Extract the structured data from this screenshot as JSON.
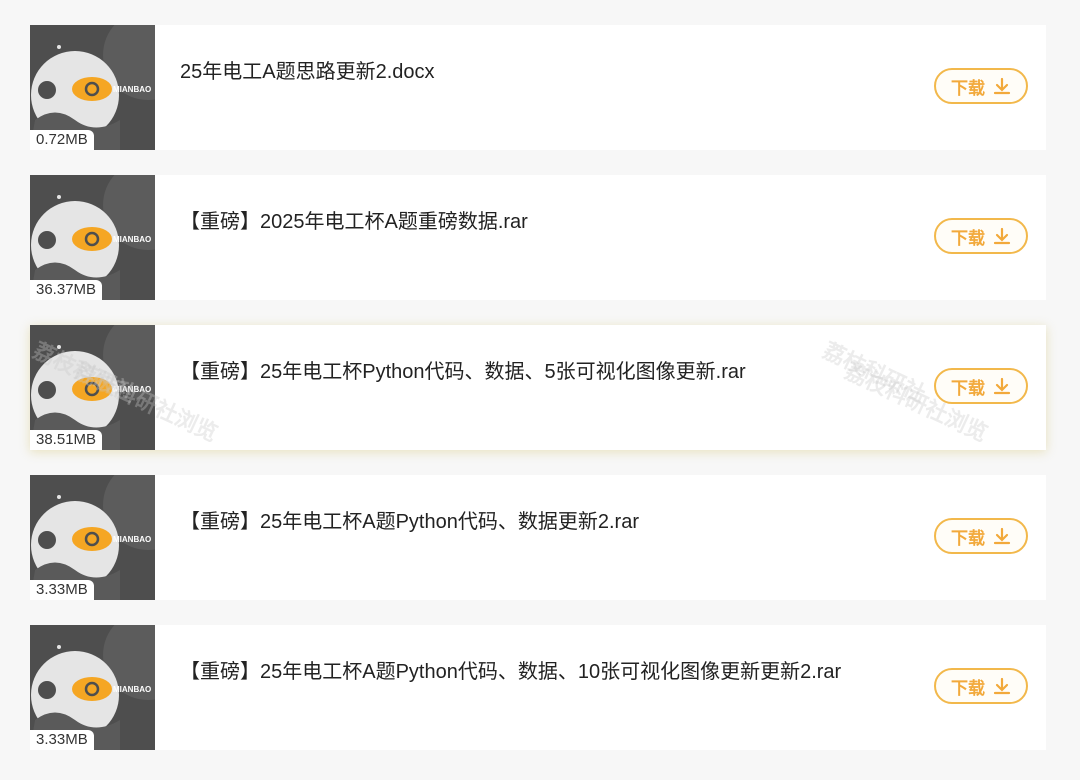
{
  "files": [
    {
      "name": "25年电工A题思路更新2.docx",
      "size": "0.72MB",
      "download_label": "下载"
    },
    {
      "name": "【重磅】2025年电工杯A题重磅数据.rar",
      "size": "36.37MB",
      "download_label": "下载"
    },
    {
      "name": "【重磅】25年电工杯Python代码、数据、5张可视化图像更新.rar",
      "size": "38.51MB",
      "download_label": "下载"
    },
    {
      "name": "【重磅】25年电工杯A题Python代码、数据更新2.rar",
      "size": "3.33MB",
      "download_label": "下载"
    },
    {
      "name": "【重磅】25年电工杯A题Python代码、数据、10张可视化图像更新更新2.rar",
      "size": "3.33MB",
      "download_label": "下载"
    }
  ],
  "thumbnail_brand": "MIANBAO",
  "watermark": {
    "line1": "荔枝科研社",
    "line2": "荔枝科研社浏览"
  },
  "colors": {
    "accent": "#f2b84b",
    "thumb_bg": "#4e4e4e",
    "eye": "#f5a623"
  }
}
